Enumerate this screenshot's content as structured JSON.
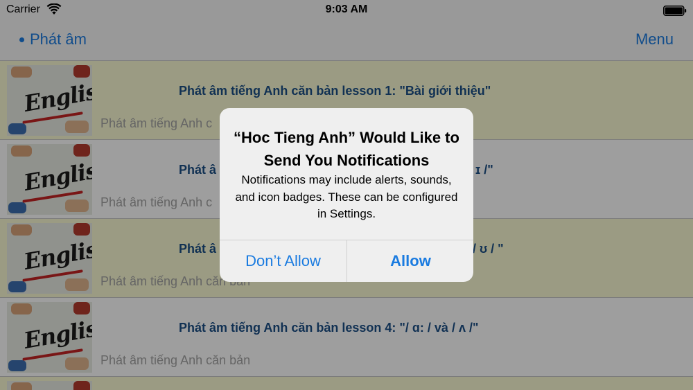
{
  "status_bar": {
    "carrier": "Carrier",
    "time": "9:03 AM",
    "wifi_icon": "wifi-icon",
    "battery_icon": "battery-icon"
  },
  "nav": {
    "back_label": "Phát âm",
    "menu_label": "Menu",
    "accent_color": "#1a7be0"
  },
  "lessons": [
    {
      "title": "Phát âm tiếng Anh căn bản lesson 1: \"Bài giới thiệu\"",
      "subtitle": "Phát âm tiếng Anh c",
      "thumb_text": "English"
    },
    {
      "title": "Phát â",
      "title_tail": "ɪ /\"",
      "subtitle": "Phát âm tiếng Anh c",
      "thumb_text": "English"
    },
    {
      "title": "Phát â",
      "title_tail": "/ ʊ / \"",
      "subtitle": "Phát âm tiếng Anh căn bản",
      "thumb_text": "English"
    },
    {
      "title": "Phát âm tiếng Anh căn bản lesson 4: \"/ ɑ: / và / ʌ /\"",
      "subtitle": "Phát âm tiếng Anh căn bản",
      "thumb_text": "English"
    }
  ],
  "alert": {
    "title": "“Hoc Tieng Anh” Would Like to Send You Notifications",
    "message": "Notifications may include alerts, sounds, and icon badges. These can be configured in Settings.",
    "dont_allow_label": "Don’t Allow",
    "allow_label": "Allow"
  }
}
